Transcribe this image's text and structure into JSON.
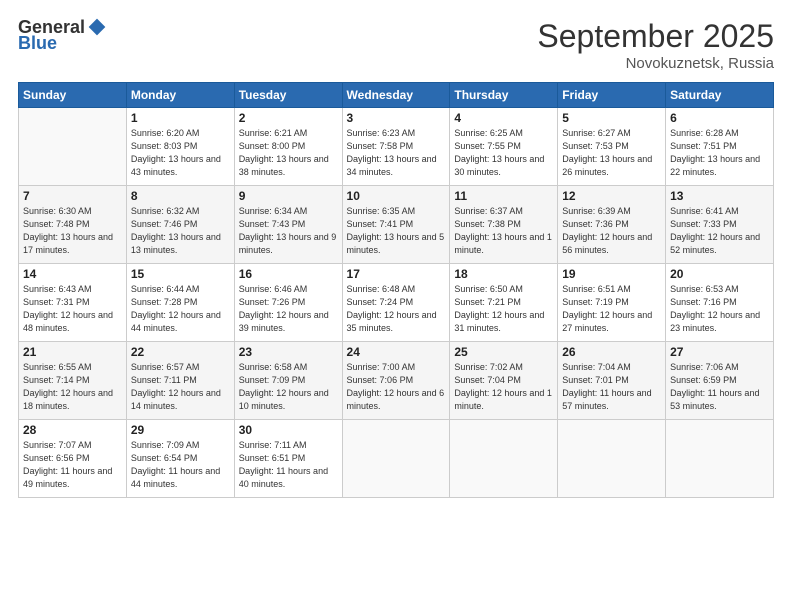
{
  "logo": {
    "general": "General",
    "blue": "Blue"
  },
  "header": {
    "month": "September 2025",
    "location": "Novokuznetsk, Russia"
  },
  "weekdays": [
    "Sunday",
    "Monday",
    "Tuesday",
    "Wednesday",
    "Thursday",
    "Friday",
    "Saturday"
  ],
  "weeks": [
    [
      {
        "day": "",
        "info": ""
      },
      {
        "day": "1",
        "info": "Sunrise: 6:20 AM\nSunset: 8:03 PM\nDaylight: 13 hours\nand 43 minutes."
      },
      {
        "day": "2",
        "info": "Sunrise: 6:21 AM\nSunset: 8:00 PM\nDaylight: 13 hours\nand 38 minutes."
      },
      {
        "day": "3",
        "info": "Sunrise: 6:23 AM\nSunset: 7:58 PM\nDaylight: 13 hours\nand 34 minutes."
      },
      {
        "day": "4",
        "info": "Sunrise: 6:25 AM\nSunset: 7:55 PM\nDaylight: 13 hours\nand 30 minutes."
      },
      {
        "day": "5",
        "info": "Sunrise: 6:27 AM\nSunset: 7:53 PM\nDaylight: 13 hours\nand 26 minutes."
      },
      {
        "day": "6",
        "info": "Sunrise: 6:28 AM\nSunset: 7:51 PM\nDaylight: 13 hours\nand 22 minutes."
      }
    ],
    [
      {
        "day": "7",
        "info": "Sunrise: 6:30 AM\nSunset: 7:48 PM\nDaylight: 13 hours\nand 17 minutes."
      },
      {
        "day": "8",
        "info": "Sunrise: 6:32 AM\nSunset: 7:46 PM\nDaylight: 13 hours\nand 13 minutes."
      },
      {
        "day": "9",
        "info": "Sunrise: 6:34 AM\nSunset: 7:43 PM\nDaylight: 13 hours\nand 9 minutes."
      },
      {
        "day": "10",
        "info": "Sunrise: 6:35 AM\nSunset: 7:41 PM\nDaylight: 13 hours\nand 5 minutes."
      },
      {
        "day": "11",
        "info": "Sunrise: 6:37 AM\nSunset: 7:38 PM\nDaylight: 13 hours\nand 1 minute."
      },
      {
        "day": "12",
        "info": "Sunrise: 6:39 AM\nSunset: 7:36 PM\nDaylight: 12 hours\nand 56 minutes."
      },
      {
        "day": "13",
        "info": "Sunrise: 6:41 AM\nSunset: 7:33 PM\nDaylight: 12 hours\nand 52 minutes."
      }
    ],
    [
      {
        "day": "14",
        "info": "Sunrise: 6:43 AM\nSunset: 7:31 PM\nDaylight: 12 hours\nand 48 minutes."
      },
      {
        "day": "15",
        "info": "Sunrise: 6:44 AM\nSunset: 7:28 PM\nDaylight: 12 hours\nand 44 minutes."
      },
      {
        "day": "16",
        "info": "Sunrise: 6:46 AM\nSunset: 7:26 PM\nDaylight: 12 hours\nand 39 minutes."
      },
      {
        "day": "17",
        "info": "Sunrise: 6:48 AM\nSunset: 7:24 PM\nDaylight: 12 hours\nand 35 minutes."
      },
      {
        "day": "18",
        "info": "Sunrise: 6:50 AM\nSunset: 7:21 PM\nDaylight: 12 hours\nand 31 minutes."
      },
      {
        "day": "19",
        "info": "Sunrise: 6:51 AM\nSunset: 7:19 PM\nDaylight: 12 hours\nand 27 minutes."
      },
      {
        "day": "20",
        "info": "Sunrise: 6:53 AM\nSunset: 7:16 PM\nDaylight: 12 hours\nand 23 minutes."
      }
    ],
    [
      {
        "day": "21",
        "info": "Sunrise: 6:55 AM\nSunset: 7:14 PM\nDaylight: 12 hours\nand 18 minutes."
      },
      {
        "day": "22",
        "info": "Sunrise: 6:57 AM\nSunset: 7:11 PM\nDaylight: 12 hours\nand 14 minutes."
      },
      {
        "day": "23",
        "info": "Sunrise: 6:58 AM\nSunset: 7:09 PM\nDaylight: 12 hours\nand 10 minutes."
      },
      {
        "day": "24",
        "info": "Sunrise: 7:00 AM\nSunset: 7:06 PM\nDaylight: 12 hours\nand 6 minutes."
      },
      {
        "day": "25",
        "info": "Sunrise: 7:02 AM\nSunset: 7:04 PM\nDaylight: 12 hours\nand 1 minute."
      },
      {
        "day": "26",
        "info": "Sunrise: 7:04 AM\nSunset: 7:01 PM\nDaylight: 11 hours\nand 57 minutes."
      },
      {
        "day": "27",
        "info": "Sunrise: 7:06 AM\nSunset: 6:59 PM\nDaylight: 11 hours\nand 53 minutes."
      }
    ],
    [
      {
        "day": "28",
        "info": "Sunrise: 7:07 AM\nSunset: 6:56 PM\nDaylight: 11 hours\nand 49 minutes."
      },
      {
        "day": "29",
        "info": "Sunrise: 7:09 AM\nSunset: 6:54 PM\nDaylight: 11 hours\nand 44 minutes."
      },
      {
        "day": "30",
        "info": "Sunrise: 7:11 AM\nSunset: 6:51 PM\nDaylight: 11 hours\nand 40 minutes."
      },
      {
        "day": "",
        "info": ""
      },
      {
        "day": "",
        "info": ""
      },
      {
        "day": "",
        "info": ""
      },
      {
        "day": "",
        "info": ""
      }
    ]
  ]
}
